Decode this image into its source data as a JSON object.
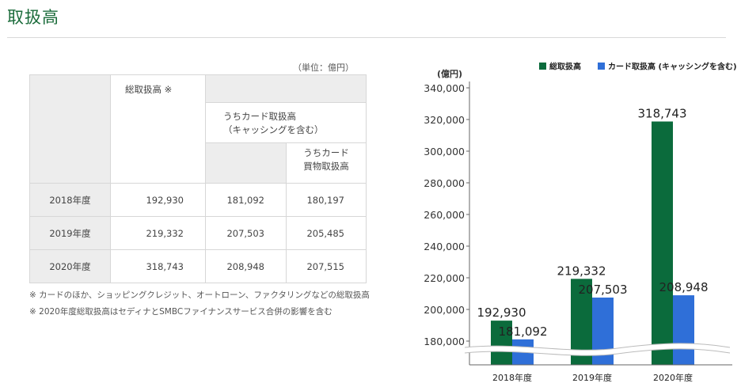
{
  "page": {
    "title": "取扱高"
  },
  "table": {
    "unit_note": "（単位：億円）",
    "headers": {
      "total": "総取扱高 ※",
      "card_line1": "うちカード取扱高",
      "card_line2": "（キャッシングを含む）",
      "shopping_line1": "うちカード",
      "shopping_line2": "買物取扱高"
    },
    "rows": [
      {
        "year": "2018年度",
        "total": "192,930",
        "card": "181,092",
        "shopping": "180,197"
      },
      {
        "year": "2019年度",
        "total": "219,332",
        "card": "207,503",
        "shopping": "205,485"
      },
      {
        "year": "2020年度",
        "total": "318,743",
        "card": "208,948",
        "shopping": "207,515"
      }
    ],
    "footnotes": [
      "※ カードのほか、ショッピングクレジット、オートローン、ファクタリングなどの総取扱高",
      "※ 2020年度総取扱高はセディナとSMBCファイナンスサービス合併の影響を含む"
    ]
  },
  "chart_data": {
    "type": "bar",
    "ylabel": "(億円)",
    "categories": [
      "2018年度",
      "2019年度",
      "2020年度"
    ],
    "series": [
      {
        "name": "総取扱高",
        "values": [
          192930,
          219332,
          318743
        ],
        "labels": [
          "192,930",
          "219,332",
          "318,743"
        ],
        "color": "#0b6b3c"
      },
      {
        "name": "カード取扱高 (キャッシングを含む)",
        "values": [
          181092,
          207503,
          208948
        ],
        "labels": [
          "181,092",
          "207,503",
          "208,948"
        ],
        "color": "#2f6fd8"
      }
    ],
    "yticks": [
      180000,
      200000,
      220000,
      240000,
      260000,
      280000,
      300000,
      320000,
      340000
    ],
    "ytick_labels": [
      "180,000",
      "200,000",
      "220,000",
      "240,000",
      "260,000",
      "280,000",
      "300,000",
      "320,000",
      "340,000"
    ],
    "ylim": [
      180000,
      340000
    ],
    "axis_break": true,
    "grid": false,
    "legend_position": "top-right"
  }
}
